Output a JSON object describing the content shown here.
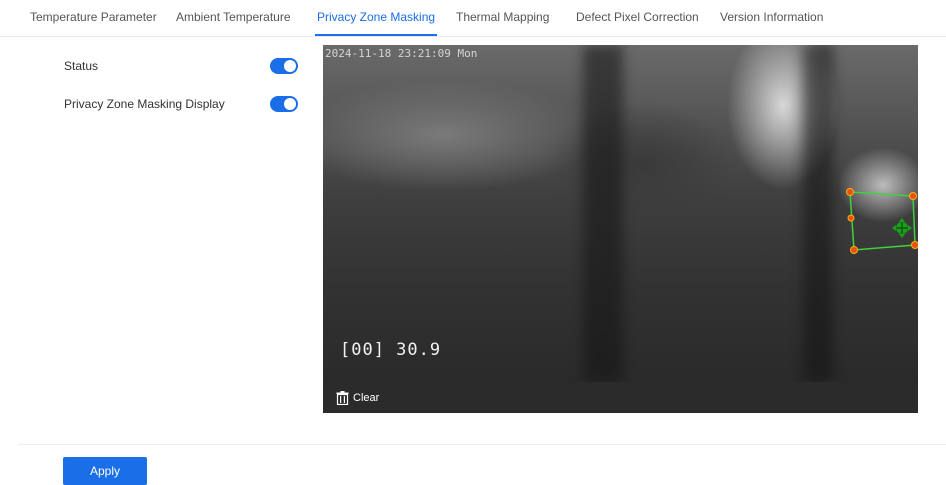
{
  "tabs": [
    {
      "label": "Temperature Parameter"
    },
    {
      "label": "Ambient Temperature"
    },
    {
      "label": "Privacy Zone Masking",
      "active": true
    },
    {
      "label": "Thermal Mapping"
    },
    {
      "label": "Defect Pixel Correction"
    },
    {
      "label": "Version Information"
    }
  ],
  "settings": {
    "status_label": "Status",
    "status_on": true,
    "display_label": "Privacy Zone Masking Display",
    "display_on": true
  },
  "video": {
    "timestamp": "2024-11-18 23:21:09 Mon",
    "temperature_overlay": "[00] 30.9",
    "clear_label": "Clear"
  },
  "actions": {
    "apply_label": "Apply"
  },
  "colors": {
    "accent": "#1a6fe8",
    "zone_outline": "#3fd13f",
    "zone_handle": "#e8501a"
  }
}
